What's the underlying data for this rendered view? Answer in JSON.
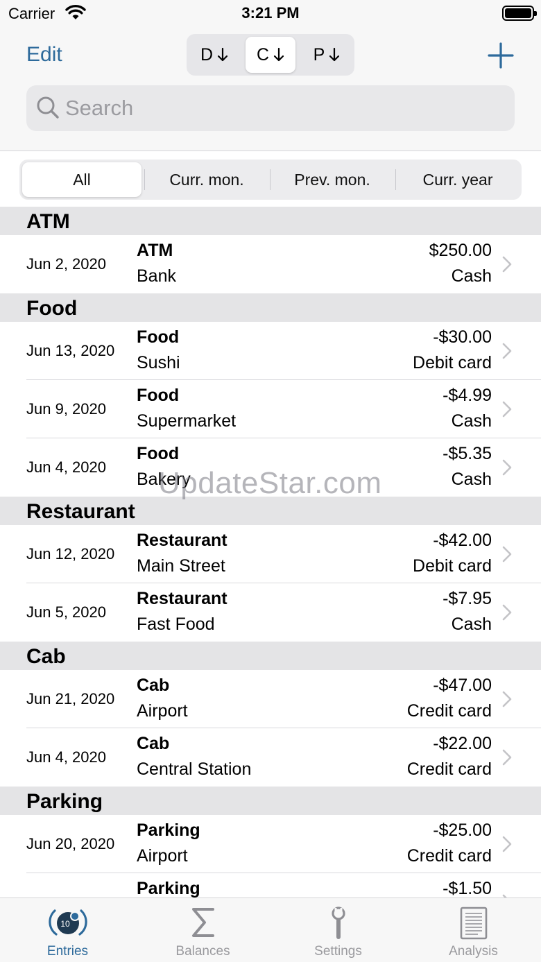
{
  "status_bar": {
    "carrier": "Carrier",
    "time": "3:21 PM"
  },
  "navbar": {
    "edit_label": "Edit",
    "sort_options": [
      {
        "label": "D",
        "selected": false
      },
      {
        "label": "C",
        "selected": true
      },
      {
        "label": "P",
        "selected": false
      }
    ],
    "add_icon": "plus-icon"
  },
  "search": {
    "placeholder": "Search",
    "value": ""
  },
  "filters": [
    {
      "label": "All",
      "selected": true
    },
    {
      "label": "Curr. mon.",
      "selected": false
    },
    {
      "label": "Prev. mon.",
      "selected": false
    },
    {
      "label": "Curr. year",
      "selected": false
    }
  ],
  "sections": [
    {
      "title": "ATM",
      "entries": [
        {
          "date": "Jun 2, 2020",
          "category": "ATM",
          "description": "Bank",
          "amount": "$250.00",
          "account": "Cash"
        }
      ]
    },
    {
      "title": "Food",
      "entries": [
        {
          "date": "Jun 13, 2020",
          "category": "Food",
          "description": "Sushi",
          "amount": "-$30.00",
          "account": "Debit card"
        },
        {
          "date": "Jun 9, 2020",
          "category": "Food",
          "description": "Supermarket",
          "amount": "-$4.99",
          "account": "Cash"
        },
        {
          "date": "Jun 4, 2020",
          "category": "Food",
          "description": "Bakery",
          "amount": "-$5.35",
          "account": "Cash"
        }
      ]
    },
    {
      "title": "Restaurant",
      "entries": [
        {
          "date": "Jun 12, 2020",
          "category": "Restaurant",
          "description": "Main Street",
          "amount": "-$42.00",
          "account": "Debit card"
        },
        {
          "date": "Jun 5, 2020",
          "category": "Restaurant",
          "description": "Fast Food",
          "amount": "-$7.95",
          "account": "Cash"
        }
      ]
    },
    {
      "title": "Cab",
      "entries": [
        {
          "date": "Jun 21, 2020",
          "category": "Cab",
          "description": "Airport",
          "amount": "-$47.00",
          "account": "Credit card"
        },
        {
          "date": "Jun 4, 2020",
          "category": "Cab",
          "description": "Central Station",
          "amount": "-$22.00",
          "account": "Credit card"
        }
      ]
    },
    {
      "title": "Parking",
      "entries": [
        {
          "date": "Jun 20, 2020",
          "category": "Parking",
          "description": "Airport",
          "amount": "-$25.00",
          "account": "Credit card"
        },
        {
          "date": "",
          "category": "Parking",
          "description": "",
          "amount": "-$1.50",
          "account": ""
        }
      ]
    }
  ],
  "watermark": "UpdateStar.com",
  "tab_bar": {
    "tabs": [
      {
        "label": "Entries",
        "icon": "entries-icon",
        "active": true,
        "badge": "10"
      },
      {
        "label": "Balances",
        "icon": "sigma-icon",
        "active": false
      },
      {
        "label": "Settings",
        "icon": "settings-icon",
        "active": false
      },
      {
        "label": "Analysis",
        "icon": "document-icon",
        "active": false
      }
    ]
  },
  "colors": {
    "accent": "#2d6a9b",
    "inactive": "#9a9a9e",
    "section_bg": "#e4e4e6",
    "bar_bg": "#f7f7f7"
  }
}
